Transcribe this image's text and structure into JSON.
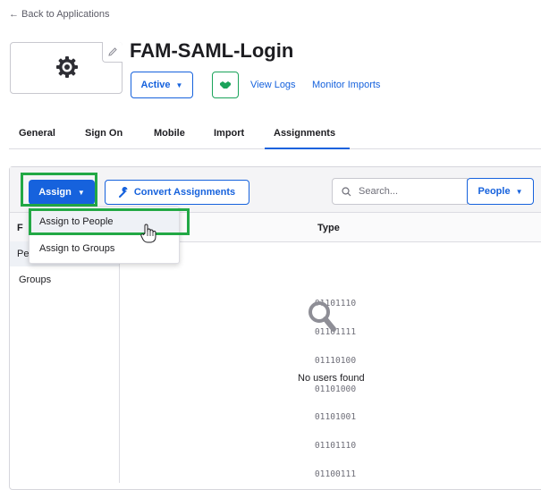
{
  "back_link": "← Back to Applications",
  "app": {
    "title": "FAM-SAML-Login",
    "status": "Active",
    "logo_icon": "gear-icon",
    "view_logs": "View Logs",
    "monitor_imports": "Monitor Imports"
  },
  "tabs": [
    {
      "label": "General",
      "active": false
    },
    {
      "label": "Sign On",
      "active": false
    },
    {
      "label": "Mobile",
      "active": false
    },
    {
      "label": "Import",
      "active": false
    },
    {
      "label": "Assignments",
      "active": true
    }
  ],
  "toolbar": {
    "assign_label": "Assign",
    "convert_label": "Convert Assignments",
    "search_placeholder": "Search...",
    "people_label": "People"
  },
  "assign_menu": {
    "items": [
      "Assign to People",
      "Assign to Groups"
    ],
    "hovered": "Assign to People"
  },
  "filters": {
    "header": "F",
    "items": [
      "Pe",
      "Groups"
    ]
  },
  "table": {
    "column_type": "Type"
  },
  "empty_state": {
    "binary_lines": [
      "01101110",
      "01101111",
      "01110100",
      "01101000",
      "01101001",
      "01101110",
      "01100111"
    ],
    "message": "No users found"
  },
  "colors": {
    "accent": "#1662dd",
    "highlight_box": "#22a845",
    "push_icon": "#1aa35a"
  }
}
